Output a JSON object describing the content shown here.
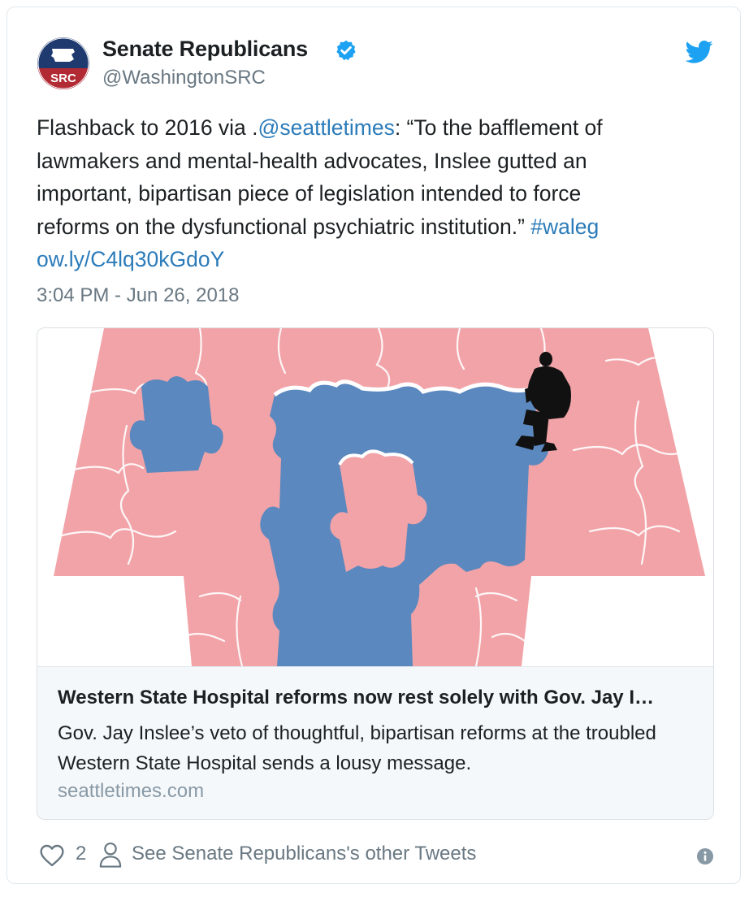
{
  "author": {
    "name": "Senate Republicans",
    "handle": "@WashingtonSRC",
    "avatar_text": "SRC",
    "verified": true
  },
  "tweet": {
    "line1_prefix": "Flashback to 2016 via .",
    "line1_mention": "@seattletimes",
    "line1_suffix": ": “To the bafflement of",
    "line2": "lawmakers and mental-health advocates, Inslee gutted an",
    "line3": "important, bipartisan piece of legislation intended to force",
    "line4_text": "reforms on the dysfunctional psychiatric institution.” ",
    "line4_hashtag": "#waleg",
    "line5_link": "ow.ly/C4lq30kGdoY",
    "timestamp": "3:04 PM - Jun 26, 2018"
  },
  "card": {
    "title": "Western State Hospital reforms now rest solely with Gov. Jay I…",
    "description_line1": "Gov. Jay Inslee’s veto of thoughtful, bipartisan reforms at the troubled",
    "description_line2": "Western State Hospital sends a lousy message.",
    "domain": "seattletimes.com"
  },
  "footer": {
    "like_count": "2",
    "see_others_label": "See Senate Republicans's other Tweets"
  },
  "colors": {
    "link": "#2b7bb9",
    "secondary_text": "#697882",
    "puzzle_pink": "#f2a3a8",
    "puzzle_blue": "#5b88be",
    "avatar_navy": "#1f3a6e",
    "avatar_red": "#b22b34",
    "twitter_blue": "#1da1f2"
  },
  "icons": [
    "verified-badge-icon",
    "twitter-bird-icon",
    "heart-icon",
    "person-icon",
    "info-icon"
  ]
}
